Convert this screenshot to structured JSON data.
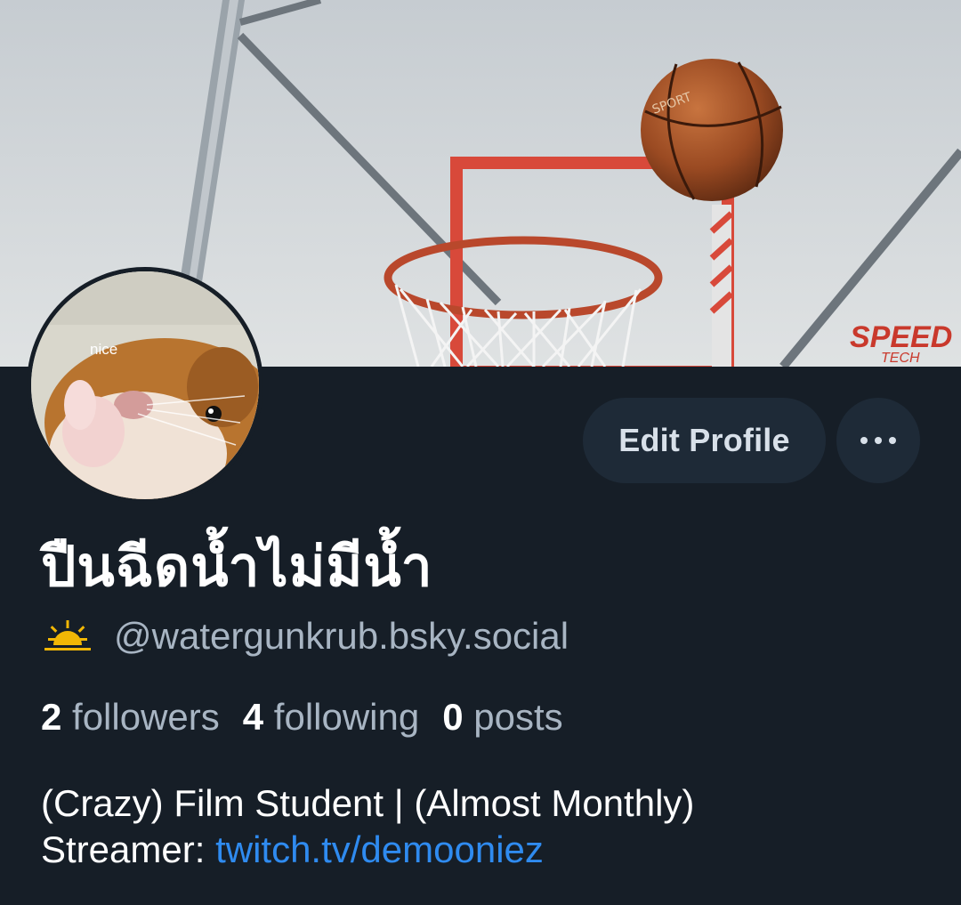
{
  "banner": {
    "image": "basketball-hoop-photo"
  },
  "avatar": {
    "image": "hamster-photo",
    "caption": "nice"
  },
  "actions": {
    "edit_profile_label": "Edit Profile",
    "more_icon": "more-horizontal-icon"
  },
  "profile": {
    "display_name": "ปืนฉีดน้ำไม่มีน้ำ",
    "handle_icon": "sunrise-icon",
    "handle": "@watergunkrub.bsky.social",
    "stats": {
      "followers_count": "2",
      "followers_label": "followers",
      "following_count": "4",
      "following_label": "following",
      "posts_count": "0",
      "posts_label": "posts"
    },
    "bio": {
      "line1": "(Crazy) Film Student | (Almost Monthly)",
      "line2_prefix": "Streamer: ",
      "link": "twitch.tv/demooniez"
    }
  },
  "colors": {
    "background": "#161e27",
    "button_bg": "#1e2a37",
    "muted_text": "#a8b5c3",
    "link": "#2f8bf0",
    "sun": "#f2b705"
  }
}
